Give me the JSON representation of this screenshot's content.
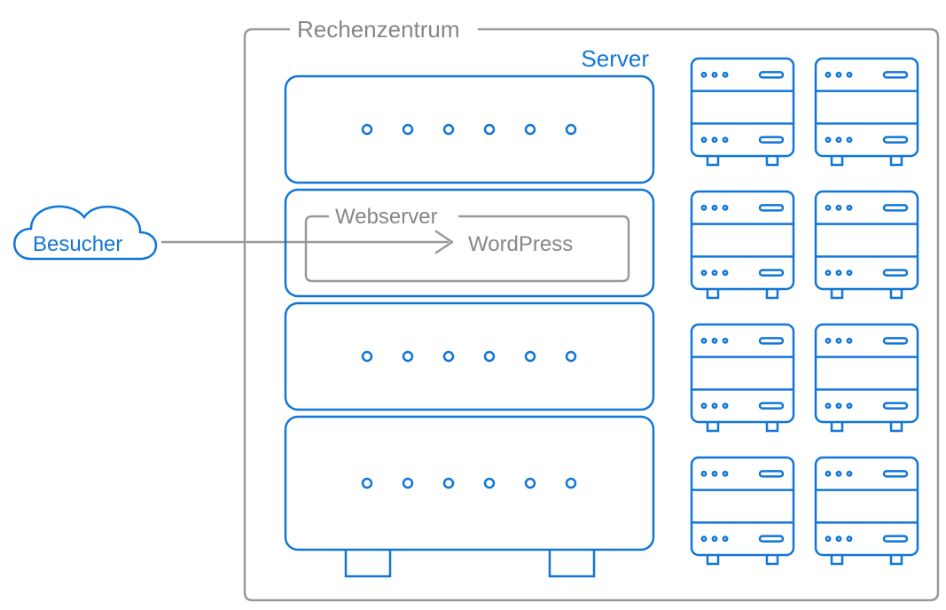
{
  "colors": {
    "blue": "#1176d6",
    "gray": "#999999"
  },
  "labels": {
    "visitor": "Besucher",
    "datacenter": "Rechenzentrum",
    "server": "Server",
    "webserver": "Webserver",
    "app": "WordPress"
  },
  "diagram": {
    "main_server_slots": 4,
    "webserver_slot_index": 1,
    "small_server_grid": {
      "rows": 4,
      "cols": 2
    }
  }
}
